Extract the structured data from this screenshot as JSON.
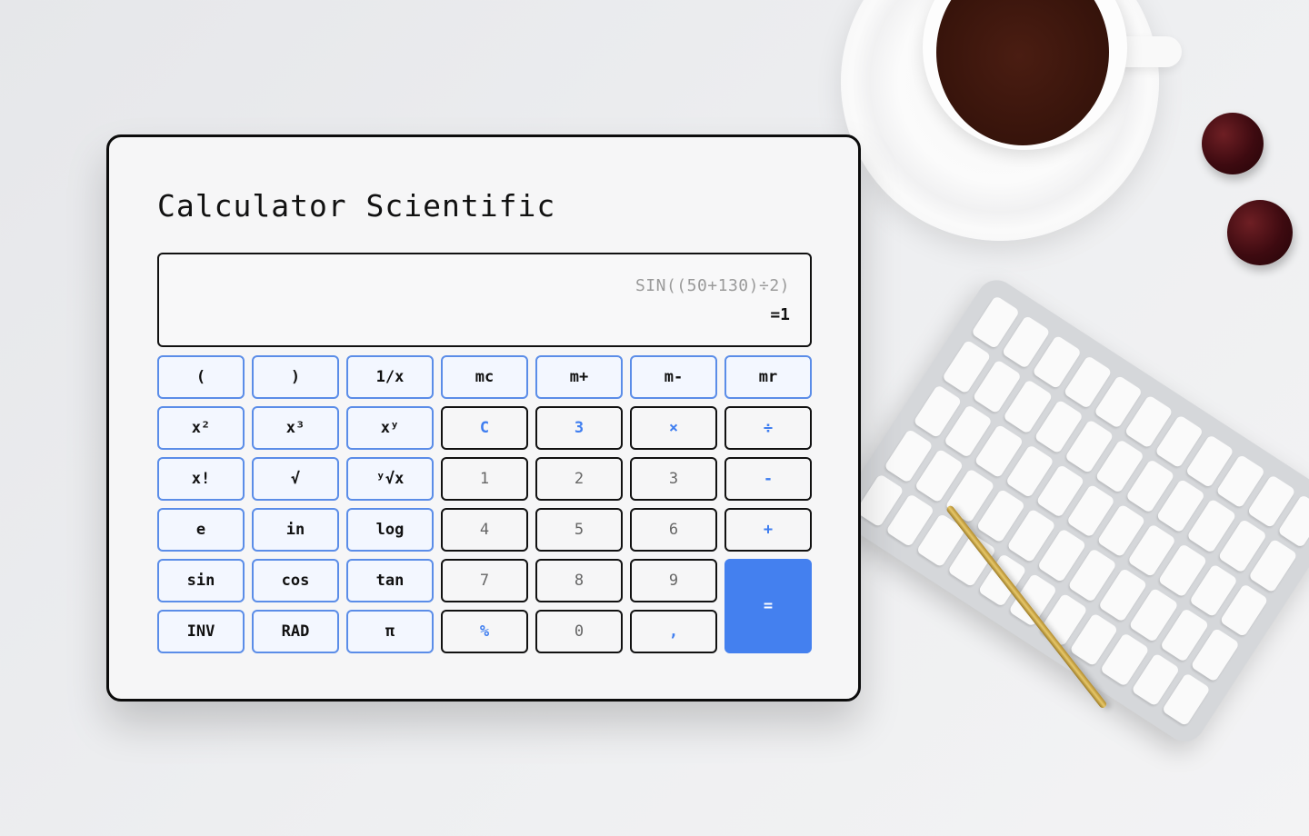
{
  "app": {
    "title": "Calculator Scientific"
  },
  "display": {
    "expression": "SIN((50+130)÷2)",
    "result": "=1"
  },
  "keys": [
    {
      "label": "(",
      "kind": "sci",
      "name": "open-paren-button"
    },
    {
      "label": ")",
      "kind": "sci",
      "name": "close-paren-button"
    },
    {
      "label": "1/x",
      "kind": "sci",
      "name": "reciprocal-button"
    },
    {
      "label": "mc",
      "kind": "sci",
      "name": "memory-clear-button"
    },
    {
      "label": "m+",
      "kind": "sci",
      "name": "memory-add-button"
    },
    {
      "label": "m-",
      "kind": "sci",
      "name": "memory-subtract-button"
    },
    {
      "label": "mr",
      "kind": "sci",
      "name": "memory-recall-button"
    },
    {
      "label": "x²",
      "kind": "sci",
      "name": "square-button"
    },
    {
      "label": "x³",
      "kind": "sci",
      "name": "cube-button"
    },
    {
      "label": "xʸ",
      "kind": "sci",
      "name": "power-button"
    },
    {
      "label": "C",
      "kind": "op",
      "name": "clear-button"
    },
    {
      "label": "3",
      "kind": "op",
      "name": "three-accent-button"
    },
    {
      "label": "×",
      "kind": "op",
      "name": "multiply-button"
    },
    {
      "label": "÷",
      "kind": "op",
      "name": "divide-button"
    },
    {
      "label": "x!",
      "kind": "sci",
      "name": "factorial-button"
    },
    {
      "label": "√",
      "kind": "sci",
      "name": "sqrt-button"
    },
    {
      "label": "ʸ√x",
      "kind": "sci",
      "name": "nth-root-button"
    },
    {
      "label": "1",
      "kind": "num",
      "name": "digit-1-button"
    },
    {
      "label": "2",
      "kind": "num",
      "name": "digit-2-button"
    },
    {
      "label": "3",
      "kind": "num",
      "name": "digit-3-button"
    },
    {
      "label": "-",
      "kind": "op",
      "name": "minus-button"
    },
    {
      "label": "e",
      "kind": "sci",
      "name": "euler-button"
    },
    {
      "label": "in",
      "kind": "sci",
      "name": "ln-button"
    },
    {
      "label": "log",
      "kind": "sci",
      "name": "log-button"
    },
    {
      "label": "4",
      "kind": "num",
      "name": "digit-4-button"
    },
    {
      "label": "5",
      "kind": "num",
      "name": "digit-5-button"
    },
    {
      "label": "6",
      "kind": "num",
      "name": "digit-6-button"
    },
    {
      "label": "+",
      "kind": "op",
      "name": "plus-button"
    },
    {
      "label": "sin",
      "kind": "sci",
      "name": "sin-button"
    },
    {
      "label": "cos",
      "kind": "sci",
      "name": "cos-button"
    },
    {
      "label": "tan",
      "kind": "sci",
      "name": "tan-button"
    },
    {
      "label": "7",
      "kind": "num",
      "name": "digit-7-button"
    },
    {
      "label": "8",
      "kind": "num",
      "name": "digit-8-button"
    },
    {
      "label": "9",
      "kind": "num",
      "name": "digit-9-button"
    },
    {
      "label": "=",
      "kind": "equals",
      "name": "equals-button"
    },
    {
      "label": "INV",
      "kind": "sci",
      "name": "inverse-button"
    },
    {
      "label": "RAD",
      "kind": "sci",
      "name": "rad-button"
    },
    {
      "label": "π",
      "kind": "sci",
      "name": "pi-button"
    },
    {
      "label": "%",
      "kind": "op",
      "name": "percent-button"
    },
    {
      "label": "0",
      "kind": "num",
      "name": "digit-0-button"
    },
    {
      "label": ",",
      "kind": "comma",
      "name": "comma-button"
    }
  ],
  "colors": {
    "accent": "#4480ef",
    "sci_border": "#5b8de8",
    "sci_fill": "#f3f7ff",
    "frame": "#0c0c0c"
  }
}
